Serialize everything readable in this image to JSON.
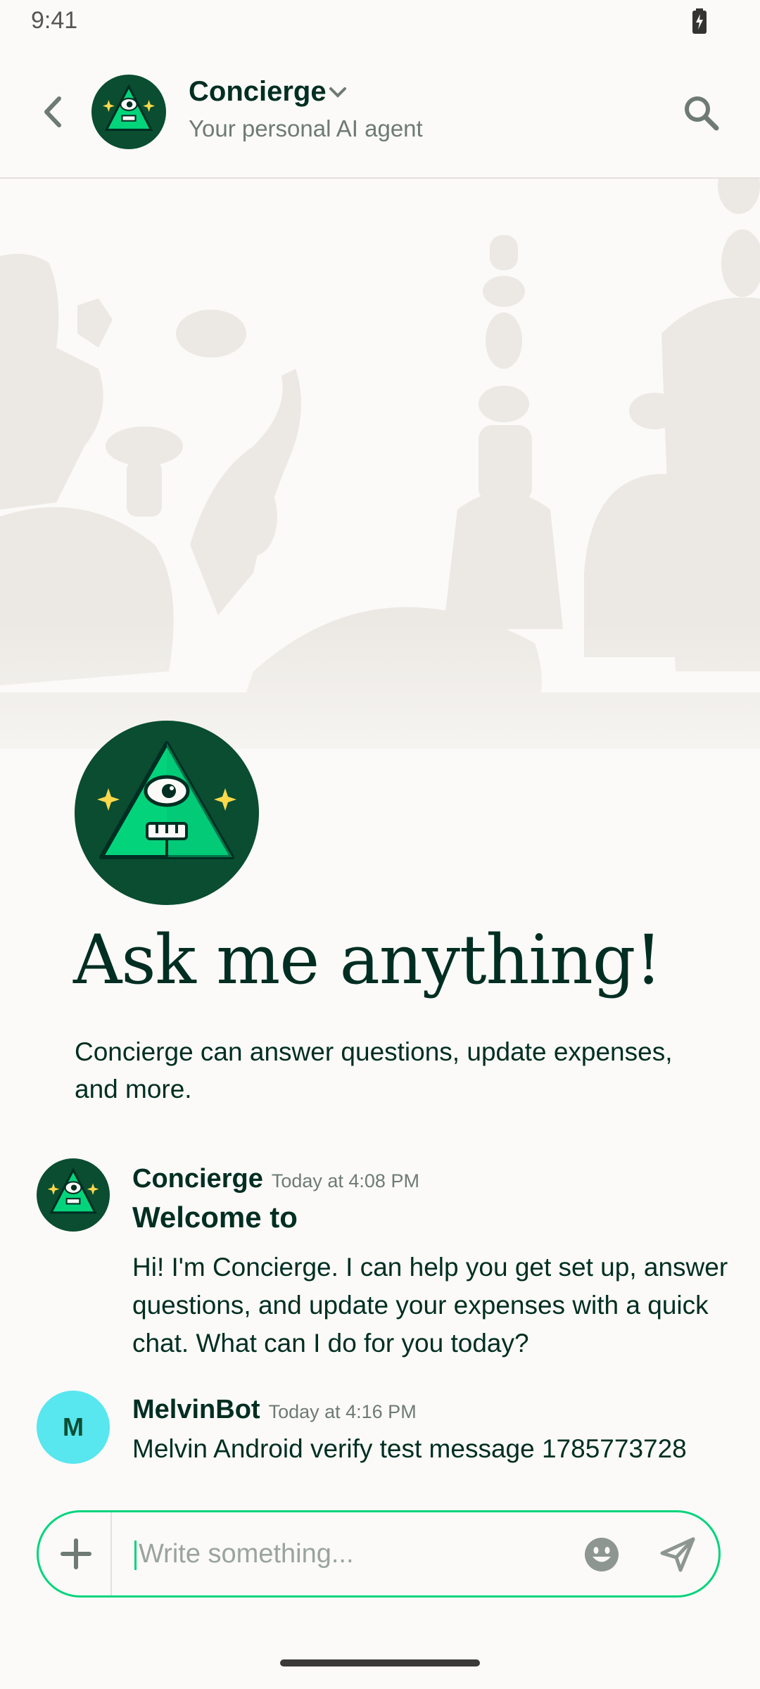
{
  "status_bar": {
    "time": "9:41"
  },
  "header": {
    "title": "Concierge",
    "subtitle": "Your personal AI agent"
  },
  "hero": {
    "title": "Ask me anything!",
    "description": "Concierge can answer questions, update expenses, and more."
  },
  "messages": [
    {
      "sender": "Concierge",
      "time": "Today at 4:08 PM",
      "heading": "Welcome to",
      "text": "Hi! I'm Concierge. I can help you get set up, answer questions, and update your expenses with a quick chat. What can I do for you today?"
    },
    {
      "sender": "MelvinBot",
      "avatar_letter": "M",
      "time": "Today at 4:16 PM",
      "text": "Melvin Android verify test message 1785773728"
    }
  ],
  "composer": {
    "placeholder": "Write something..."
  },
  "colors": {
    "accent": "#03d47c",
    "dark_green": "#0a4d31",
    "text": "#002e22",
    "muted": "#6e7b74",
    "bot_avatar": "#58e6ef"
  }
}
